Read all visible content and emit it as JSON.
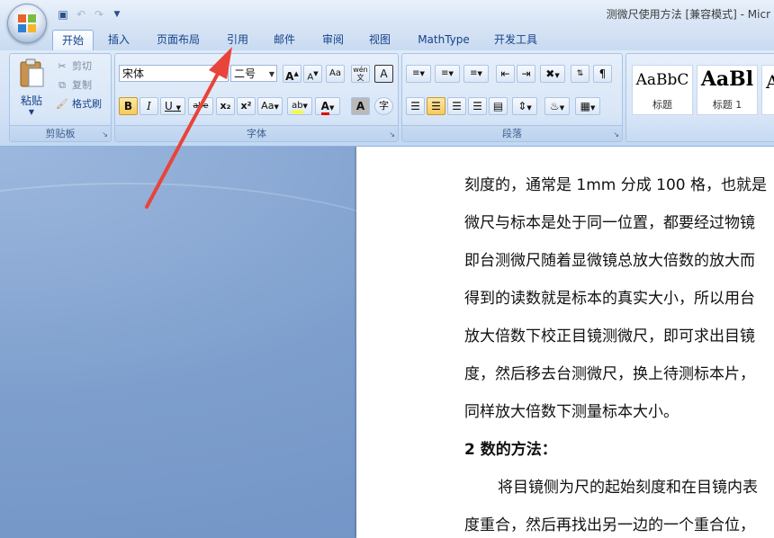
{
  "window": {
    "title": "测微尺使用方法 [兼容模式] - Micr"
  },
  "quick_access": [
    "save-icon",
    "undo-icon",
    "redo-icon",
    "customize-icon"
  ],
  "tabs": [
    {
      "label": "开始",
      "active": true
    },
    {
      "label": "插入"
    },
    {
      "label": "页面布局"
    },
    {
      "label": "引用"
    },
    {
      "label": "邮件"
    },
    {
      "label": "审阅"
    },
    {
      "label": "视图"
    },
    {
      "label": "MathType"
    },
    {
      "label": "开发工具"
    }
  ],
  "clipboard": {
    "label": "剪贴板",
    "paste": "粘贴",
    "cut": "剪切",
    "copy": "复制",
    "format_painter": "格式刷"
  },
  "font": {
    "label": "字体",
    "family": "宋体",
    "size": "二号",
    "grow": "A",
    "shrink": "A",
    "clear": "Aa",
    "phonetic": "wén",
    "border_char": "A",
    "bold": "B",
    "italic": "I",
    "underline": "U",
    "strike": "abe",
    "subscript": "x₂",
    "superscript": "x²",
    "change_case": "Aa",
    "highlight": "ab",
    "font_color": "A",
    "shading": "A",
    "enclose": "字"
  },
  "paragraph": {
    "label": "段落"
  },
  "styles": [
    {
      "sample": "AaBbC",
      "name": "标题"
    },
    {
      "sample": "AaBl",
      "name": "标题 1"
    },
    {
      "sample": "A",
      "name": ""
    }
  ],
  "document": {
    "lines": [
      "刻度的，通常是 1mm 分成 100 格，也就是",
      "微尺与标本是处于同一位置，都要经过物镜",
      "即台测微尺随着显微镜总放大倍数的放大而",
      "得到的读数就是标本的真实大小，所以用台",
      "放大倍数下校正目镜测微尺，即可求出目镜",
      "度，然后移去台测微尺，换上待测标本片，",
      "同样放大倍数下测量标本大小。"
    ],
    "heading": "2 数的方法：",
    "para2": [
      "将目镜侧为尺的起始刻度和在目镜内表",
      "度重合，然后再找出另一边的一个重合位，"
    ]
  },
  "colors": {
    "highlight": "#ffff00",
    "font_color": "#e00000",
    "annotation_arrow": "#e8443a"
  }
}
